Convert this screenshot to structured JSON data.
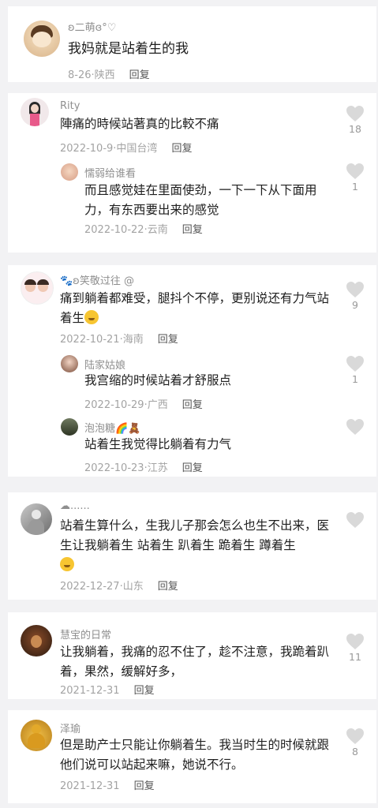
{
  "comments": [
    {
      "user": "ʚ二萌ɞ°♡",
      "text": "我妈就是站着生的我",
      "date": "8-26",
      "location": "陕西",
      "reply": "回复"
    },
    {
      "user": "Rity",
      "text": "陣痛的時候站著真的比較不痛",
      "date": "2022-10-9",
      "location": "中国台湾",
      "reply": "回复",
      "likes": "18",
      "replies": [
        {
          "user": "懦弱给谁看",
          "text": "而且感觉娃在里面使劲，一下一下从下面用力，有东西要出来的感觉",
          "date": "2022-10-22",
          "location": "云南",
          "reply": "回复",
          "likes": "1"
        }
      ]
    },
    {
      "user": "🐾ʚ笑敬过往 @",
      "text": "痛到躺着都难受，腿抖个不停，更别说还有力气站着生",
      "date": "2022-10-21",
      "location": "海南",
      "reply": "回复",
      "likes": "9",
      "replies": [
        {
          "user": "陆家姑娘",
          "text": "我宫缩的时候站着才舒服点",
          "date": "2022-10-29",
          "location": "广西",
          "reply": "回复",
          "likes": "1"
        },
        {
          "user": "泡泡糖🌈🧸",
          "text": "站着生我觉得比躺着有力气",
          "date": "2022-10-23",
          "location": "江苏",
          "reply": "回复"
        }
      ]
    },
    {
      "user": "☁......",
      "text": "站着生算什么，生我儿子那会怎么也生不出来，医生让我躺着生 站着生 趴着生 跪着生 蹲着生",
      "date": "2022-12-27",
      "location": "山东",
      "reply": "回复"
    },
    {
      "user": "慧宝的日常",
      "text": "让我躺着，我痛的忍不住了，趁不注意，我跪着趴着，果然，缓解好多，",
      "date": "2021-12-31",
      "location": "",
      "reply": "回复",
      "likes": "11"
    },
    {
      "user": "泽瑜",
      "text": "但是助产士只能让你躺着生。我当时生的时候就跟他们说可以站起来嘛，她说不行。",
      "date": "2021-12-31",
      "location": "",
      "reply": "回复",
      "likes": "8"
    }
  ],
  "colors": {
    "background": "#f2f2f4",
    "card": "#ffffff",
    "username": "#8f8f8f",
    "meta": "#a3a3a3",
    "heart": "#d9d9d9"
  }
}
